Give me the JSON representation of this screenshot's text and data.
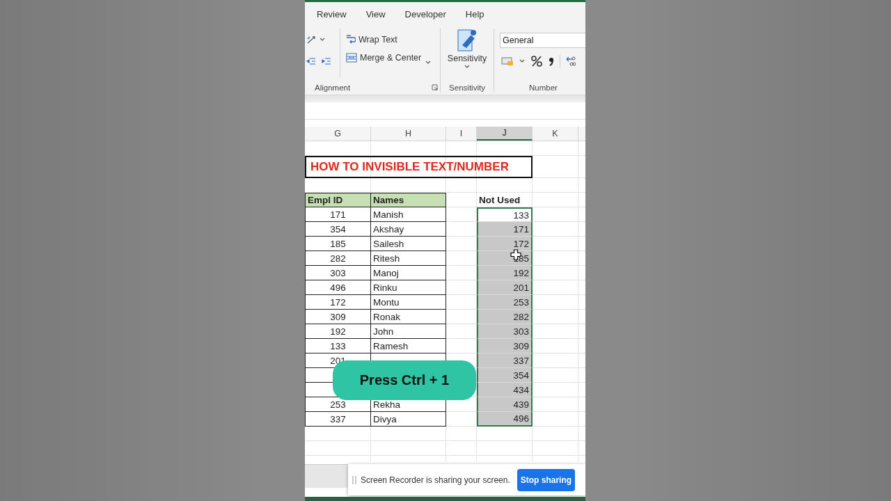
{
  "ribbon": {
    "tabs": [
      "Review",
      "View",
      "Developer",
      "Help"
    ],
    "groups": [
      {
        "kind": "alignment",
        "label": "Alignment",
        "buttons": [
          "Wrap Text",
          "Merge & Center"
        ]
      },
      {
        "kind": "sensitivity",
        "label": "Sensitivity",
        "button": "Sensitivity"
      },
      {
        "kind": "number",
        "label": "Number",
        "format": "General"
      }
    ]
  },
  "sheet": {
    "columns": [
      {
        "label": "G",
        "selected": false
      },
      {
        "label": "H",
        "selected": false
      },
      {
        "label": "I",
        "selected": false
      },
      {
        "label": "J",
        "selected": true
      },
      {
        "label": "K",
        "selected": false
      }
    ],
    "title": "HOW TO INVISIBLE TEXT/NUMBER",
    "table": {
      "columns": [
        "Empl ID",
        "Names"
      ],
      "rows": [
        {
          "empl_id": "171",
          "name": "Manish"
        },
        {
          "empl_id": "354",
          "name": "Akshay"
        },
        {
          "empl_id": "185",
          "name": "Sailesh"
        },
        {
          "empl_id": "282",
          "name": "Ritesh"
        },
        {
          "empl_id": "303",
          "name": "Manoj"
        },
        {
          "empl_id": "496",
          "name": "Rinku"
        },
        {
          "empl_id": "172",
          "name": "Montu"
        },
        {
          "empl_id": "309",
          "name": "Ronak"
        },
        {
          "empl_id": "192",
          "name": "John"
        },
        {
          "empl_id": "133",
          "name": "Ramesh"
        },
        {
          "empl_id": "201"
        },
        {},
        {},
        {
          "empl_id": "253",
          "name": "Rekha"
        },
        {
          "empl_id": "337",
          "name": "Divya"
        }
      ]
    },
    "not_used": {
      "header": "Not Used",
      "cells": [
        {
          "value": "133",
          "active": true
        },
        {
          "value": "171",
          "active": false
        },
        {
          "value": "172",
          "active": false
        },
        {
          "value": "185",
          "active": false
        },
        {
          "value": "192",
          "active": false
        },
        {
          "value": "201",
          "active": false
        },
        {
          "value": "253",
          "active": false
        },
        {
          "value": "282",
          "active": false
        },
        {
          "value": "303",
          "active": false
        },
        {
          "value": "309",
          "active": false
        },
        {
          "value": "337",
          "active": false
        },
        {
          "value": "354",
          "active": false
        },
        {
          "value": "434",
          "active": false
        },
        {
          "value": "439",
          "active": false
        },
        {
          "value": "496",
          "active": false
        }
      ]
    }
  },
  "overlay": {
    "text": "Press Ctrl + 1"
  },
  "notification": {
    "message": "Screen Recorder is sharing your screen.",
    "button": "Stop sharing"
  }
}
